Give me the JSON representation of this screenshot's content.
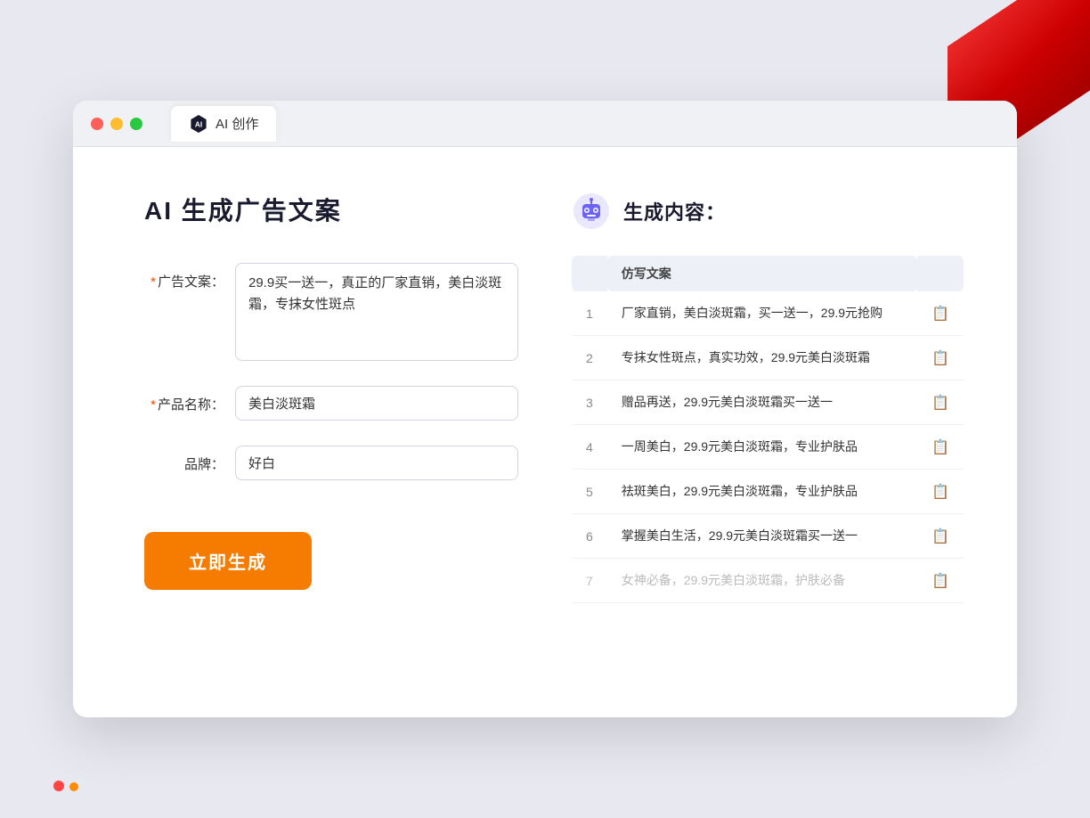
{
  "window": {
    "tab_label": "AI 创作"
  },
  "page": {
    "title": "AI 生成广告文案",
    "result_title": "生成内容："
  },
  "form": {
    "ad_copy_label": "广告文案：",
    "ad_copy_required": "*",
    "ad_copy_value": "29.9买一送一，真正的厂家直销，美白淡斑霜，专抹女性斑点",
    "product_name_label": "产品名称：",
    "product_name_required": "*",
    "product_name_value": "美白淡斑霜",
    "brand_label": "品牌：",
    "brand_value": "好白",
    "generate_button_label": "立即生成"
  },
  "results": {
    "table_header": "仿写文案",
    "items": [
      {
        "num": "1",
        "text": "厂家直销，美白淡斑霜，买一送一，29.9元抢购",
        "faded": false
      },
      {
        "num": "2",
        "text": "专抹女性斑点，真实功效，29.9元美白淡斑霜",
        "faded": false
      },
      {
        "num": "3",
        "text": "赠品再送，29.9元美白淡斑霜买一送一",
        "faded": false
      },
      {
        "num": "4",
        "text": "一周美白，29.9元美白淡斑霜，专业护肤品",
        "faded": false
      },
      {
        "num": "5",
        "text": "祛斑美白，29.9元美白淡斑霜，专业护肤品",
        "faded": false
      },
      {
        "num": "6",
        "text": "掌握美白生活，29.9元美白淡斑霜买一送一",
        "faded": false
      },
      {
        "num": "7",
        "text": "女神必备，29.9元美白淡斑霜，护肤必备",
        "faded": true
      }
    ]
  }
}
